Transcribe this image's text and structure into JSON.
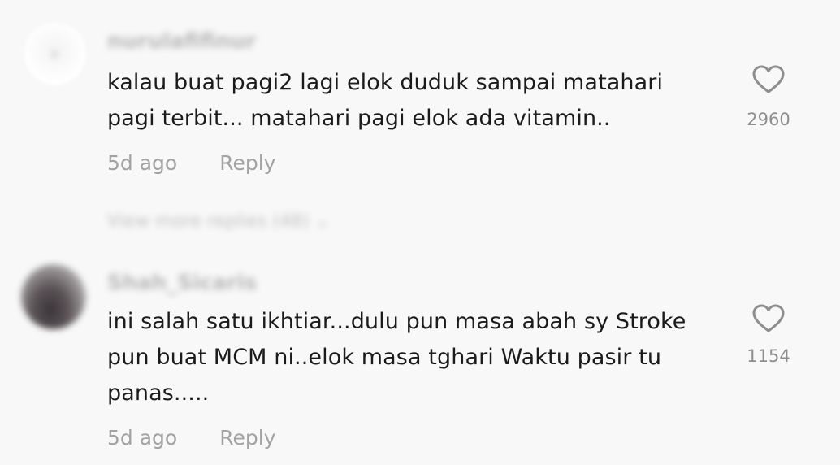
{
  "comments": [
    {
      "username": "nurulafifinur",
      "text": "kalau buat pagi2 lagi elok duduk sampai matahari\npagi terbit... matahari pagi elok ada vitamin..",
      "timestamp": "5d ago",
      "reply_label": "Reply",
      "likes": "2960",
      "avatar_icon": "avatar-placeholder-icon"
    },
    {
      "username": "Shah_Sicaris",
      "text": "ini salah satu ikhtiar...dulu pun masa abah sy Stroke\npun buat MCM ni..elok masa tghari Waktu pasir tu\npanas.....",
      "timestamp": "5d ago",
      "reply_label": "Reply",
      "likes": "1154",
      "avatar_icon": "avatar-photo"
    }
  ],
  "view_replies": {
    "label": "View more replies (48) ⌄"
  },
  "colors": {
    "background": "#f8f8f8",
    "text": "#1b1b1b",
    "meta": "#a2a2a2",
    "heart": "#8e8e8e"
  },
  "icons": {
    "like": "heart-outline-icon"
  }
}
